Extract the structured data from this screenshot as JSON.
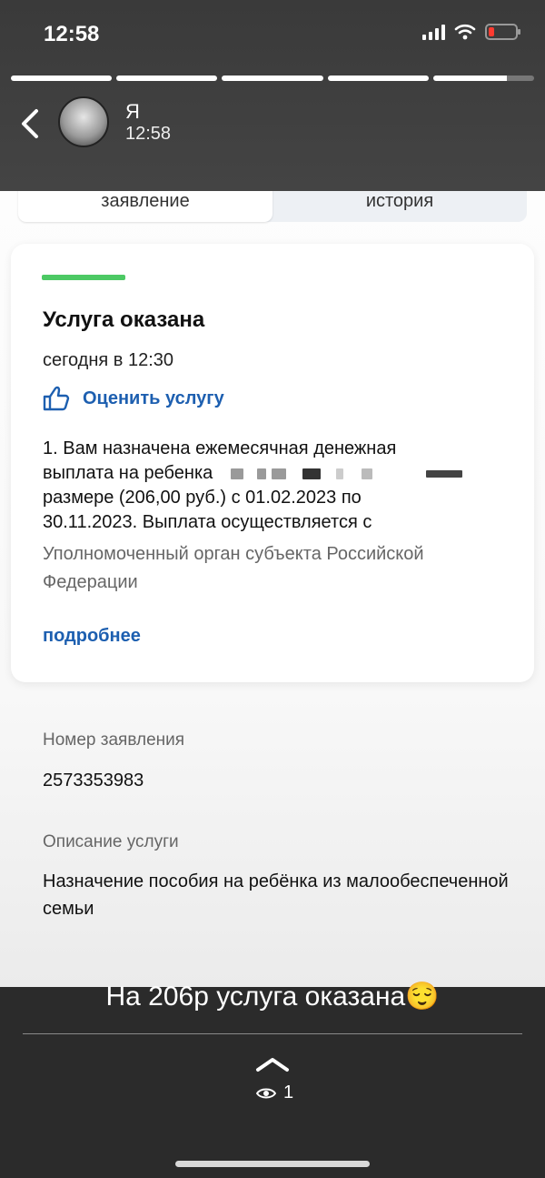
{
  "status_bar": {
    "time": "12:58",
    "battery_color": "#ff3b30"
  },
  "story": {
    "user": "Я",
    "time": "12:58",
    "segments": 5,
    "caption": "На 206р услуга оказана😌",
    "views": "1"
  },
  "tabs": [
    {
      "label": "заявление",
      "active": true
    },
    {
      "label": "история",
      "active": false
    }
  ],
  "card": {
    "accent_color": "#4cc964",
    "title": "Услуга оказана",
    "date": "сегодня в 12:30",
    "rate_label": "Оценить услугу",
    "body_line1": "1. Вам назначена ежемесячная денежная",
    "body_line2_prefix": "выплата на ребенка",
    "body_line3": "размере (206,00 руб.) с 01.02.2023 по",
    "body_line4": "30.11.2023. Выплата осуществляется с",
    "authority": "Уполномоченный орган субъекта Российской Федерации",
    "more_link": "подробнее",
    "link_color": "#1d5fb0"
  },
  "details": {
    "number_label": "Номер заявления",
    "number_value": "2573353983",
    "description_label": "Описание услуги",
    "description_value": "Назначение пособия на ребёнка из малообеспеченной семьи"
  },
  "icons": [
    "back-chevron-icon",
    "avatar",
    "signal-icon",
    "wifi-icon",
    "battery-icon",
    "thumbs-up-icon",
    "chevron-up-icon",
    "eye-icon"
  ]
}
